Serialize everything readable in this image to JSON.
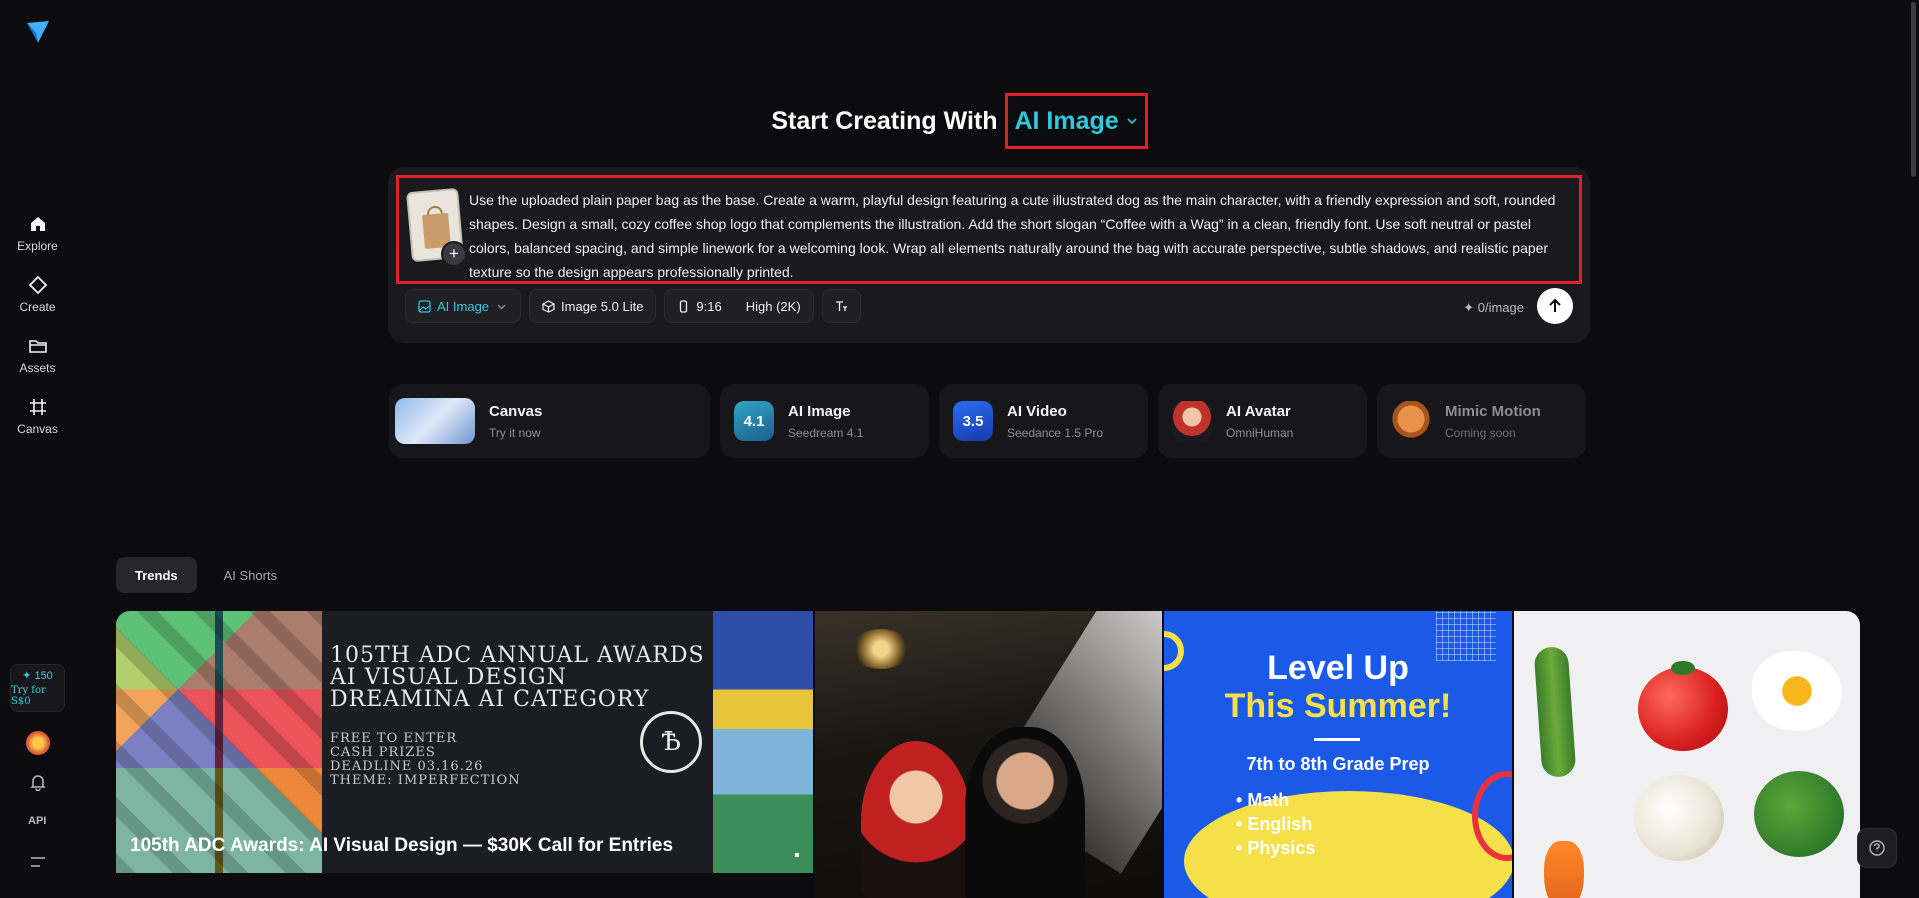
{
  "sidebar": {
    "items": [
      {
        "label": "Explore",
        "icon": "home-icon"
      },
      {
        "label": "Create",
        "icon": "diamond-icon"
      },
      {
        "label": "Assets",
        "icon": "folder-icon"
      },
      {
        "label": "Canvas",
        "icon": "canvas-frame-icon"
      }
    ],
    "credits_amount": "✦ 150",
    "credits_offer": "Try for S$0",
    "api_label": "API"
  },
  "hero": {
    "prefix": "Start Creating With",
    "mode": "AI Image"
  },
  "prompt": {
    "text": "Use the uploaded plain paper bag as the base. Create a warm, playful design featuring a cute illustrated dog as the main character, with a friendly expression and soft, rounded shapes. Design a small, cozy coffee shop logo that complements the illustration. Add the short slogan “Coffee with a Wag” in a clean, friendly font. Use soft neutral or pastel colors, balanced spacing, and simple linework for a welcoming look. Wrap all elements naturally around the bag with accurate perspective, subtle shadows, and realistic paper texture so the design appears professionally printed.",
    "add_label": "+"
  },
  "toolbar": {
    "mode": "AI Image",
    "model": "Image 5.0 Lite",
    "ratio": "9:16",
    "quality": "High (2K)",
    "cost": "✦ 0/image"
  },
  "features": [
    {
      "title": "Canvas",
      "subtitle": "Try it now"
    },
    {
      "title": "AI Image",
      "subtitle": "Seedream 4.1",
      "badge": "4.1"
    },
    {
      "title": "AI Video",
      "subtitle": "Seedance 1.5 Pro",
      "badge": "3.5"
    },
    {
      "title": "AI Avatar",
      "subtitle": "OmniHuman"
    },
    {
      "title": "Mimic Motion",
      "subtitle": "Coming soon"
    }
  ],
  "tabs": [
    {
      "label": "Trends",
      "active": true
    },
    {
      "label": "AI Shorts",
      "active": false
    }
  ],
  "gallery": {
    "card1": {
      "poster_lines": [
        "105TH ADC ANNUAL AWARDS",
        "AI VISUAL DESIGN",
        "DREAMINA AI CATEGORY"
      ],
      "poster_sub": [
        "FREE TO ENTER",
        "CASH PRIZES",
        "DEADLINE 03.16.26",
        "THEME: IMPERFECTION"
      ],
      "caption": "105th ADC Awards: AI Visual Design — $30K Call for Entries"
    },
    "card3": {
      "headline_1": "Level Up",
      "headline_2": "This Summer!",
      "sub": "7th to 8th Grade Prep",
      "list": [
        "Math",
        "English",
        "Physics"
      ]
    }
  },
  "colors": {
    "accent": "#2ec8e0",
    "highlight_box": "#e0202a",
    "background": "#0c0c0e"
  }
}
